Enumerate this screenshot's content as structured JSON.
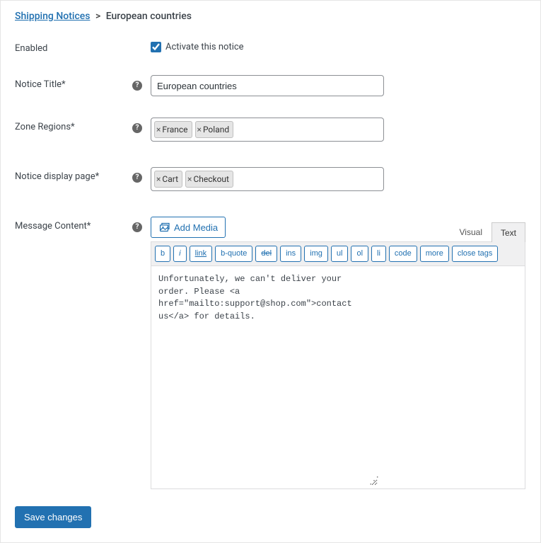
{
  "breadcrumb": {
    "parent": "Shipping Notices",
    "current": "European countries"
  },
  "fields": {
    "enabled": {
      "label": "Enabled",
      "checkbox_label": "Activate this notice",
      "checked": true
    },
    "title": {
      "label": "Notice Title*",
      "value": "European countries"
    },
    "zones": {
      "label": "Zone Regions*",
      "chips": [
        "France",
        "Poland"
      ]
    },
    "display_page": {
      "label": "Notice display page*",
      "chips": [
        "Cart",
        "Checkout"
      ]
    },
    "message": {
      "label": "Message Content*",
      "add_media": "Add Media",
      "tabs": {
        "visual": "Visual",
        "text": "Text"
      },
      "quicktags": {
        "b": "b",
        "i": "i",
        "link": "link",
        "bquote": "b-quote",
        "del": "del",
        "ins": "ins",
        "img": "img",
        "ul": "ul",
        "ol": "ol",
        "li": "li",
        "code": "code",
        "more": "more",
        "close": "close tags"
      },
      "content": "Unfortunately, we can't deliver your order. Please <a href=\"mailto:support@shop.com\">contact us</a> for details."
    }
  },
  "actions": {
    "save": "Save changes"
  }
}
